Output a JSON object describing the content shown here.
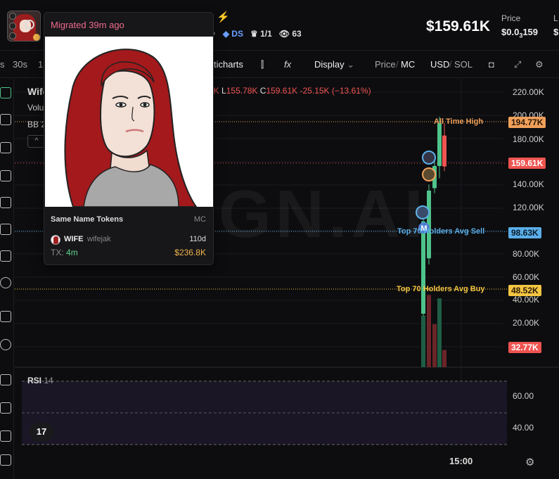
{
  "header": {
    "token_market_cap": "$159.61K",
    "price_label": "Price",
    "price_value_prefix": "$0.0",
    "price_value_sub": "3",
    "price_value_suffix": "159",
    "ds_label": "DS",
    "holders_ratio": "1/1",
    "watchers": "63",
    "lightning_icon": "lightning-icon",
    "right_cut_label": "L"
  },
  "toolbar": {
    "intervals": [
      "s",
      "30s",
      "1"
    ],
    "charts_label": "ticharts",
    "display_label": "Display",
    "price_toggle": "Price",
    "mc_toggle": "MC",
    "usd_toggle": "USD",
    "sol_toggle": "SOL",
    "slash": "/"
  },
  "chart": {
    "legend_title": "Wife",
    "volume_label": "Volu",
    "bb_label": "BB 2",
    "ohlc": {
      "h_partial": "7K",
      "l_label": "L",
      "l_value": "155.78K",
      "c_label": "C",
      "c_value": "159.61K",
      "change": "-25.15K (−13.61%)"
    },
    "watermark": "GN.AI",
    "y_ticks": [
      "220.00K",
      "200.00K",
      "180.00K",
      "140.00K",
      "120.00K",
      "80.00K",
      "60.00K",
      "40.00K",
      "20.00K"
    ],
    "price_tags": {
      "ath": "194.77K",
      "current": "159.61K",
      "avg_sell": "98.63K",
      "avg_buy": "48.52K",
      "volume": "32.77K"
    },
    "lines": {
      "ath_label": "All Time High",
      "avg_sell_label": "Top 70 Holders Avg Sell",
      "avg_buy_label": "Top 70 Holders Avg Buy"
    },
    "rsi_label": "RSI",
    "rsi_period": "14",
    "rsi_ticks": [
      "60.00",
      "40.00"
    ],
    "time_tick": "15:00",
    "tv_logo": "17",
    "colors": {
      "up": "#4fc38a",
      "down": "#ef5350",
      "ath": "#f0a05a",
      "avg_sell": "#5aaee8",
      "avg_buy": "#f4c542"
    }
  },
  "chart_data": {
    "type": "candlestick",
    "y_unit": "market cap (USD)",
    "ylim": [
      0,
      230000
    ],
    "candles": [
      {
        "open": 40000,
        "high": 120000,
        "low": 30000,
        "close": 115000
      },
      {
        "open": 85000,
        "high": 145000,
        "low": 80000,
        "close": 140000
      },
      {
        "open": 142000,
        "high": 170000,
        "low": 138000,
        "close": 160000
      },
      {
        "open": 160000,
        "high": 200000,
        "low": 150000,
        "close": 194770
      },
      {
        "open": 184760,
        "high": 194770,
        "low": 155780,
        "close": 159610
      }
    ],
    "volume_bars": [
      {
        "value": 30000,
        "direction": "up"
      },
      {
        "value": 42000,
        "direction": "down"
      },
      {
        "value": 25000,
        "direction": "down"
      },
      {
        "value": 40000,
        "direction": "up"
      },
      {
        "value": 10000,
        "direction": "down"
      }
    ]
  },
  "popover": {
    "migrated_text": "Migrated 39m ago",
    "same_name_title": "Same Name Tokens",
    "mc_header": "MC",
    "token_symbol": "WIFE",
    "token_name": "wifejak",
    "token_age": "110d",
    "tx_label": "TX:",
    "tx_value": "4m",
    "token_mc": "$236.8K"
  }
}
